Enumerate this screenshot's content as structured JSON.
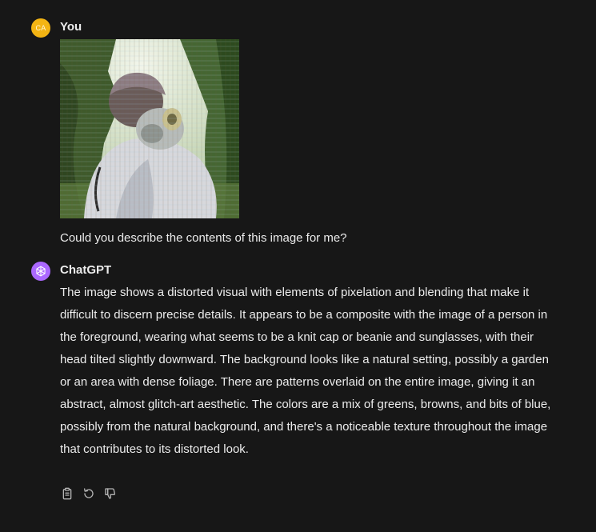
{
  "user": {
    "avatar_initials": "CA",
    "name": "You",
    "message": "Could you describe the contents of this image for me?",
    "attachment_icon": "photo-thumbnail"
  },
  "assistant": {
    "name": "ChatGPT",
    "avatar_icon": "openai-logo-icon",
    "message": "The image shows a distorted visual with elements of pixelation and blending that make it difficult to discern precise details. It appears to be a composite with the image of a person in the foreground, wearing what seems to be a knit cap or beanie and sunglasses, with their head tilted slightly downward. The background looks like a natural setting, possibly a garden or an area with dense foliage. There are patterns overlaid on the entire image, giving it an abstract, almost glitch-art aesthetic. The colors are a mix of greens, browns, and bits of blue, possibly from the natural background, and there's a noticeable texture throughout the image that contributes to its distorted look.",
    "actions": [
      {
        "name": "copy",
        "icon": "clipboard-icon"
      },
      {
        "name": "regenerate",
        "icon": "refresh-icon"
      },
      {
        "name": "thumbs-down",
        "icon": "thumbs-down-icon"
      }
    ]
  },
  "colors": {
    "background": "#171717",
    "text": "#ececec",
    "user_avatar": "#f3b413",
    "assistant_avatar": "#ab68ff",
    "icon": "#b4b4b4"
  }
}
